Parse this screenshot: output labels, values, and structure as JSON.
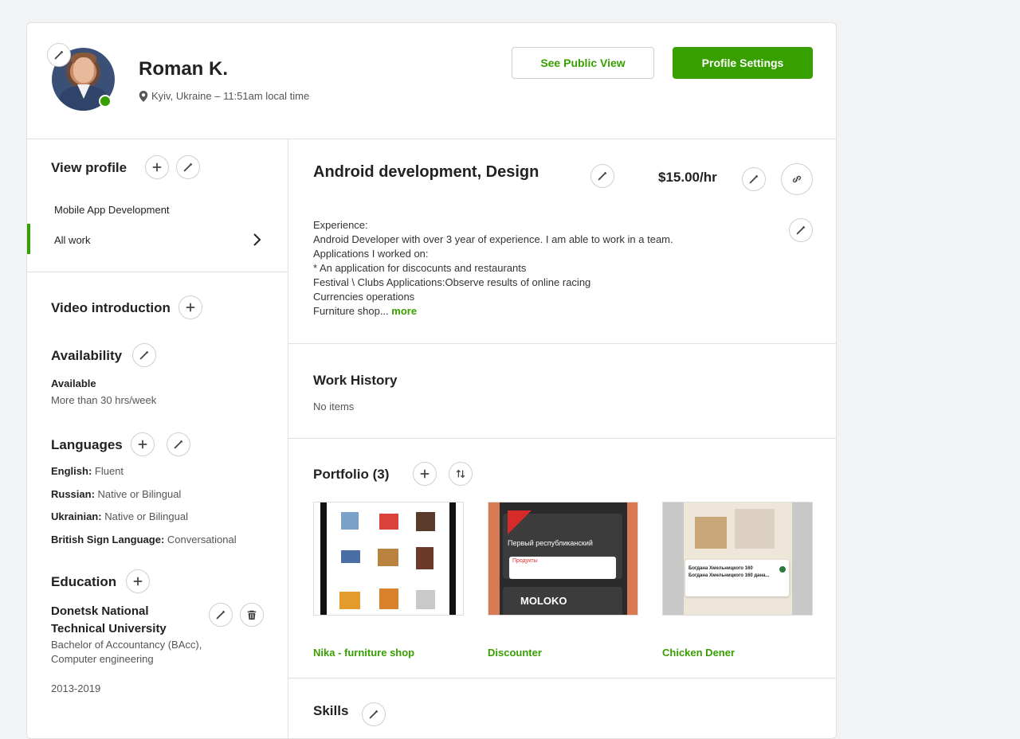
{
  "header": {
    "name": "Roman K.",
    "location": "Kyiv, Ukraine – 11:51am local time",
    "public_view_label": "See Public View",
    "profile_settings_label": "Profile Settings"
  },
  "sidebar": {
    "view_profile_title": "View profile",
    "nav_items": [
      {
        "label": "Mobile App Development"
      },
      {
        "label": "All work"
      }
    ],
    "video_intro_title": "Video introduction",
    "availability": {
      "title": "Availability",
      "status": "Available",
      "hours": "More than 30 hrs/week"
    },
    "languages": {
      "title": "Languages",
      "items": [
        {
          "name": "English:",
          "level": "Fluent"
        },
        {
          "name": "Russian:",
          "level": "Native or Bilingual"
        },
        {
          "name": "Ukrainian:",
          "level": "Native or Bilingual"
        },
        {
          "name": "British Sign Language:",
          "level": "Conversational"
        }
      ]
    },
    "education": {
      "title": "Education",
      "school": "Donetsk National Technical University",
      "degree": "Bachelor of Accountancy (BAcc), Computer engineering",
      "years": "2013-2019"
    }
  },
  "main": {
    "title": "Android development, Design",
    "rate": "$15.00/hr",
    "description": [
      "Experience:",
      "Android Developer with over 3 year of experience. I am able to work in a team.",
      "Applications I worked on:",
      "* An application for discocunts and restaurants",
      "Festival \\ Clubs Applications:Observe results of online racing",
      "Currencies operations"
    ],
    "description_last": "Furniture shop... ",
    "more_label": "more",
    "work_history": {
      "title": "Work History",
      "empty": "No items"
    },
    "portfolio": {
      "title": "Portfolio (3)",
      "items": [
        {
          "label": "Nika - furniture shop"
        },
        {
          "label": "Discounter"
        },
        {
          "label": "Chicken Dener"
        }
      ],
      "thumb_texts": {
        "discounter_place": "Первый республиканский",
        "discounter_products": "Продукты",
        "discounter_brand": "MOLOKO",
        "chicken_line1": "Богдана Хмельницкого 160",
        "chicken_line2": "Богдана Хмельницкого 160 дана..."
      }
    },
    "skills": {
      "title": "Skills"
    }
  },
  "colors": {
    "accent": "#37a000",
    "border": "#e0e0e0",
    "background": "#f2f3f5"
  },
  "icons": [
    "pencil-icon",
    "plus-icon",
    "chevron-right-icon",
    "location-pin-icon",
    "link-icon",
    "sort-icon",
    "trash-icon"
  ]
}
